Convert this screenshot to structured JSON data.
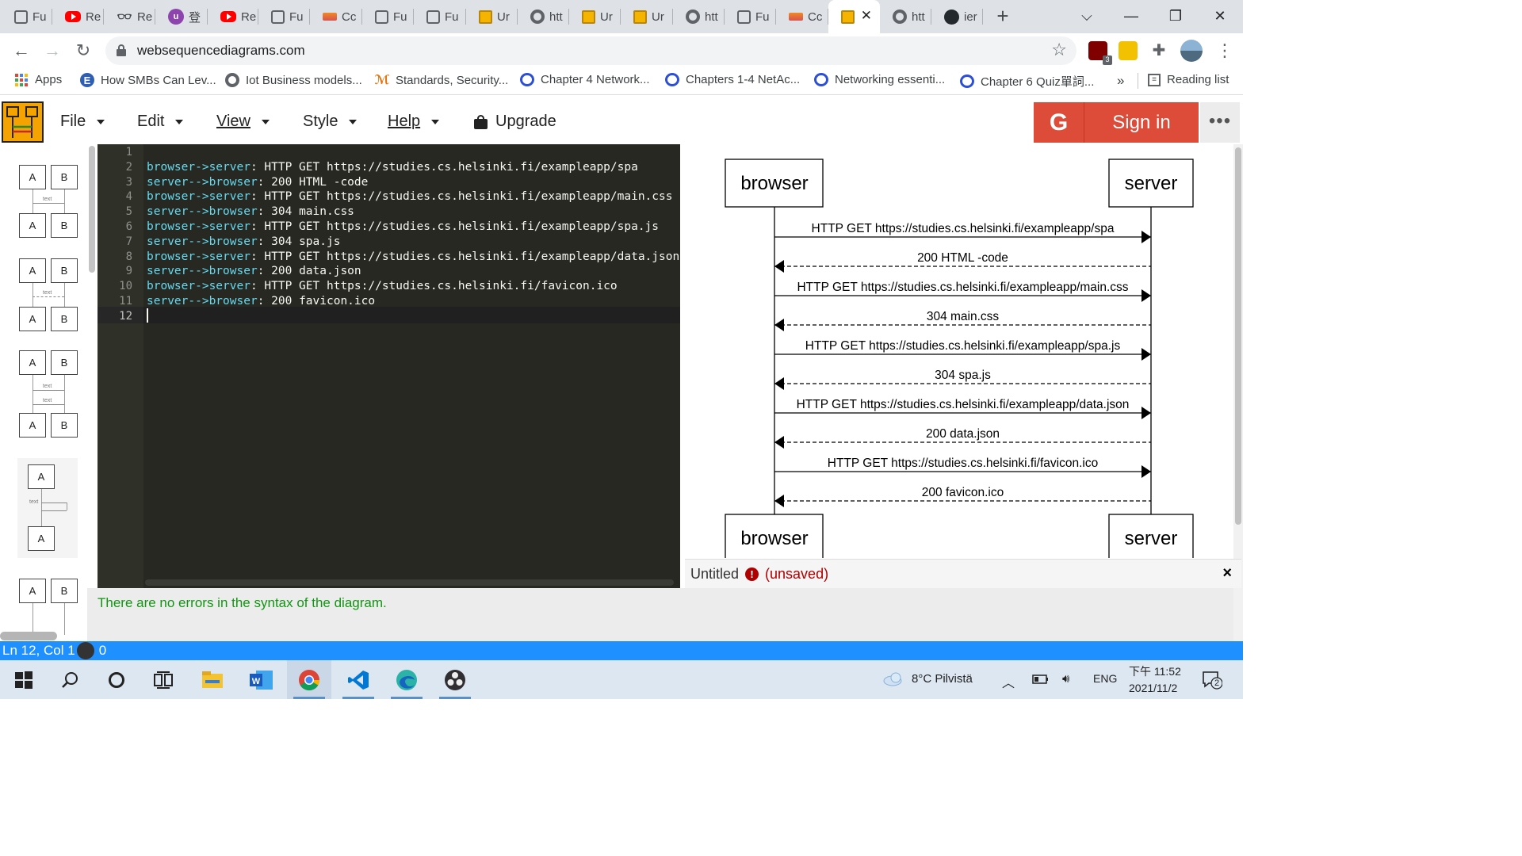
{
  "browser": {
    "tabs": [
      {
        "label": "Fu",
        "icon": "page-icon"
      },
      {
        "label": "Re",
        "icon": "youtube-icon"
      },
      {
        "label": "Re",
        "icon": "glasses-icon"
      },
      {
        "label": "登",
        "icon": "purple-circle-icon",
        "glyph": "ⓤ"
      },
      {
        "label": "Re",
        "icon": "youtube-icon"
      },
      {
        "label": "Fu",
        "icon": "page-icon"
      },
      {
        "label": "Cc",
        "icon": "orange-banner-icon"
      },
      {
        "label": "Fu",
        "icon": "page-icon"
      },
      {
        "label": "Fu",
        "icon": "page-icon"
      },
      {
        "label": "Ur",
        "icon": "sequence-diagram-icon"
      },
      {
        "label": "htt",
        "icon": "globe-icon"
      },
      {
        "label": "Ur",
        "icon": "sequence-diagram-icon"
      },
      {
        "label": "Ur",
        "icon": "sequence-diagram-icon"
      },
      {
        "label": "htt",
        "icon": "globe-icon"
      },
      {
        "label": "Fu",
        "icon": "page-icon"
      },
      {
        "label": "Cc",
        "icon": "orange-banner-icon"
      },
      {
        "label": "",
        "icon": "sequence-diagram-icon",
        "active": true
      },
      {
        "label": "htt",
        "icon": "globe-icon"
      },
      {
        "label": "ier",
        "icon": "github-icon"
      }
    ],
    "new_tab_glyph": "+",
    "tab_close_glyph": "✕",
    "window_controls": {
      "search_tabs": "⌵",
      "minimize": "—",
      "restore": "❐",
      "close": "✕"
    },
    "nav": {
      "back": "←",
      "forward": "→",
      "reload": "↻"
    },
    "url": "websequencediagrams.com",
    "star_glyph": "☆",
    "extensions": [
      {
        "name": "ublock-extension-icon",
        "badge": "3",
        "color": "#800000"
      },
      {
        "name": "note-extension-icon",
        "badge": "",
        "color": "#f2c200"
      },
      {
        "name": "puzzle-extensions-icon",
        "badge": "",
        "color": "#5f6368"
      }
    ],
    "menu_glyph": "⋮",
    "bookmarks": [
      {
        "label": "Apps",
        "icon": "apps-grid-icon"
      },
      {
        "label": "How SMBs Can Lev...",
        "icon": "edge-e-icon"
      },
      {
        "label": "Iot Business models...",
        "icon": "globe-icon"
      },
      {
        "label": "Standards, Security...",
        "icon": "standards-icon"
      },
      {
        "label": "Chapter 4 Network...",
        "icon": "quizlet-q-icon"
      },
      {
        "label": "Chapters 1-4 NetAc...",
        "icon": "quizlet-q-icon"
      },
      {
        "label": "Networking essenti...",
        "icon": "quizlet-q-icon"
      },
      {
        "label": "Chapter 6 Quiz單詞...",
        "icon": "quizlet-q-icon"
      }
    ],
    "bookmarks_overflow": "»",
    "reading_list": "Reading list"
  },
  "app": {
    "menus": [
      {
        "label": "File",
        "underline": false
      },
      {
        "label": "Edit",
        "underline": false
      },
      {
        "label": "View",
        "underline": true
      },
      {
        "label": "Style",
        "underline": false
      },
      {
        "label": "Help",
        "underline": true
      }
    ],
    "upgrade_label": "Upgrade",
    "signin_label": "Sign in",
    "google_glyph": "G",
    "more_glyph": "•••",
    "brand_color": "#dd4b39",
    "editor": {
      "lines": [
        "",
        "browser->server: HTTP GET https://studies.cs.helsinki.fi/exampleapp/spa",
        "server-->browser: 200 HTML -code",
        "browser->server: HTTP GET https://studies.cs.helsinki.fi/exampleapp/main.css",
        "server-->browser: 304 main.css",
        "browser->server: HTTP GET https://studies.cs.helsinki.fi/exampleapp/spa.js",
        "server-->browser: 304 spa.js",
        "browser->server: HTTP GET https://studies.cs.helsinki.fi/exampleapp/data.json",
        "server-->browser: 200 data.json",
        "browser->server: HTTP GET https://studies.cs.helsinki.fi/favicon.ico",
        "server-->browser: 200 favicon.ico",
        ""
      ]
    },
    "diagram": {
      "participants": [
        "browser",
        "server"
      ],
      "messages": [
        {
          "text": "HTTP GET https://studies.cs.helsinki.fi/exampleapp/spa",
          "dir": "right",
          "dashed": false
        },
        {
          "text": "200 HTML -code",
          "dir": "left",
          "dashed": true
        },
        {
          "text": "HTTP GET https://studies.cs.helsinki.fi/exampleapp/main.css",
          "dir": "right",
          "dashed": false
        },
        {
          "text": "304 main.css",
          "dir": "left",
          "dashed": true
        },
        {
          "text": "HTTP GET https://studies.cs.helsinki.fi/exampleapp/spa.js",
          "dir": "right",
          "dashed": false
        },
        {
          "text": "304 spa.js",
          "dir": "left",
          "dashed": true
        },
        {
          "text": "HTTP GET https://studies.cs.helsinki.fi/exampleapp/data.json",
          "dir": "right",
          "dashed": false
        },
        {
          "text": "200 data.json",
          "dir": "left",
          "dashed": true
        },
        {
          "text": "HTTP GET https://studies.cs.helsinki.fi/favicon.ico",
          "dir": "right",
          "dashed": false
        },
        {
          "text": "200 favicon.ico",
          "dir": "left",
          "dashed": true
        }
      ]
    },
    "templates": {
      "box_a": "A",
      "box_b": "B",
      "text_label": "text"
    },
    "document": {
      "title": "Untitled",
      "status": "(unsaved)",
      "warn_glyph": "!",
      "close_glyph": "×"
    },
    "syntax_message": "There are no errors in the syntax of the diagram.",
    "statusbar": {
      "position": "Ln 12, Col 1",
      "errors": "0"
    }
  },
  "taskbar": {
    "weather": "8°C  Pilvistä",
    "lang": "ENG",
    "time": "下午 11:52",
    "date": "2021/11/2",
    "notifications": "2",
    "apps": [
      "start-icon",
      "search-icon",
      "cortana-icon",
      "task-view-icon",
      "file-explorer-icon",
      "word-icon",
      "chrome-icon",
      "vscode-icon",
      "edge-icon",
      "obs-icon"
    ]
  }
}
